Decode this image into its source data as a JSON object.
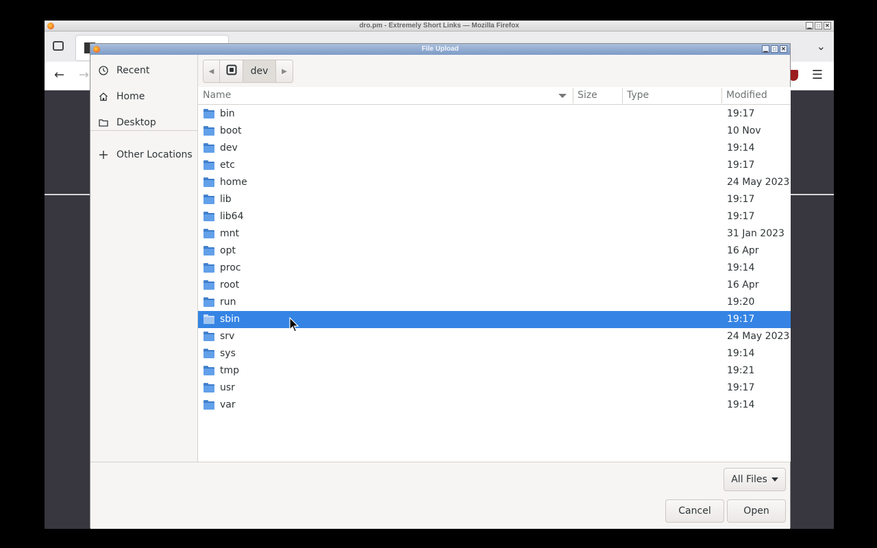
{
  "firefox": {
    "window_title": "dro.pm - Extremely Short Links — Mozilla Firefox",
    "wm_buttons": [
      "▁",
      "□",
      "✕"
    ]
  },
  "dialog": {
    "title": "File Upload",
    "sidebar": [
      {
        "label": "Recent",
        "icon": "clock-icon"
      },
      {
        "label": "Home",
        "icon": "home-icon"
      },
      {
        "label": "Desktop",
        "icon": "folder-icon"
      },
      {
        "label": "Other Locations",
        "icon": "plus-icon"
      }
    ],
    "path": {
      "current": "dev"
    },
    "columns": {
      "name": "Name",
      "size": "Size",
      "type": "Type",
      "modified": "Modified"
    },
    "files": [
      {
        "name": "bin",
        "modified": "19:17"
      },
      {
        "name": "boot",
        "modified": "10 Nov"
      },
      {
        "name": "dev",
        "modified": "19:14"
      },
      {
        "name": "etc",
        "modified": "19:17"
      },
      {
        "name": "home",
        "modified": "24 May 2023"
      },
      {
        "name": "lib",
        "modified": "19:17"
      },
      {
        "name": "lib64",
        "modified": "19:17"
      },
      {
        "name": "mnt",
        "modified": "31 Jan 2023"
      },
      {
        "name": "opt",
        "modified": "16 Apr"
      },
      {
        "name": "proc",
        "modified": "19:14"
      },
      {
        "name": "root",
        "modified": "16 Apr"
      },
      {
        "name": "run",
        "modified": "19:20"
      },
      {
        "name": "sbin",
        "modified": "19:17",
        "selected": true
      },
      {
        "name": "srv",
        "modified": "24 May 2023"
      },
      {
        "name": "sys",
        "modified": "19:14"
      },
      {
        "name": "tmp",
        "modified": "19:21"
      },
      {
        "name": "usr",
        "modified": "19:17"
      },
      {
        "name": "var",
        "modified": "19:14"
      }
    ],
    "filter_label": "All Files",
    "cancel_label": "Cancel",
    "open_label": "Open"
  },
  "colors": {
    "selection": "#3584e4",
    "folder": "#62a0ea"
  }
}
